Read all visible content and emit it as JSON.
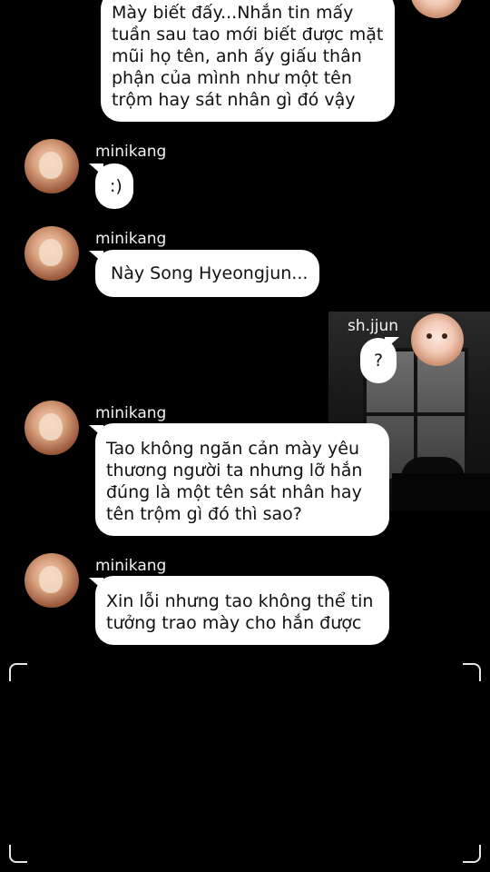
{
  "messages": [
    {
      "sender": "",
      "side": "right",
      "text": " Mày biết đấy...Nhắn tin mấy tuần sau tao mới biết được mặt mũi họ tên, anh ấy giấu thân phận của mình như một tên trộm hay sát nhân gì đó vậy"
    },
    {
      "sender": "minikang",
      "side": "left",
      "text": ":)"
    },
    {
      "sender": "minikang",
      "side": "left",
      "text": "Này Song Hyeongjun..."
    },
    {
      "sender": "sh.jjun",
      "side": "right",
      "text": "?"
    },
    {
      "sender": "minikang",
      "side": "left",
      "text": " Tao không ngăn cản mày yêu thương người ta nhưng lỡ hắn đúng là một tên sát nhân hay tên trộm gì đó thì sao?"
    },
    {
      "sender": "minikang",
      "side": "left",
      "text": " Xin lỗi nhưng tao không thể tin tưởng trao mày cho hắn được"
    }
  ],
  "lines": {
    "m0": [
      " Mày biết đấy...Nhắn tin mấy",
      "tuần sau tao mới biết được mặt",
      "mũi họ tên, anh ấy giấu thân",
      "phận của mình như một tên",
      "trộm hay sát nhân gì đó vậy"
    ],
    "m4": [
      " Tao không ngăn cản mày yêu",
      "thương người ta nhưng lỡ hắn",
      "đúng là một tên sát nhân hay",
      "tên trộm gì đó thì sao?"
    ],
    "m5": [
      " Xin lỗi nhưng tao không thể tin",
      "tưởng trao mày cho hắn được"
    ]
  },
  "colors": {
    "background": "#000000",
    "bubble": "#ffffff",
    "name_text": "#f2f2f2"
  }
}
